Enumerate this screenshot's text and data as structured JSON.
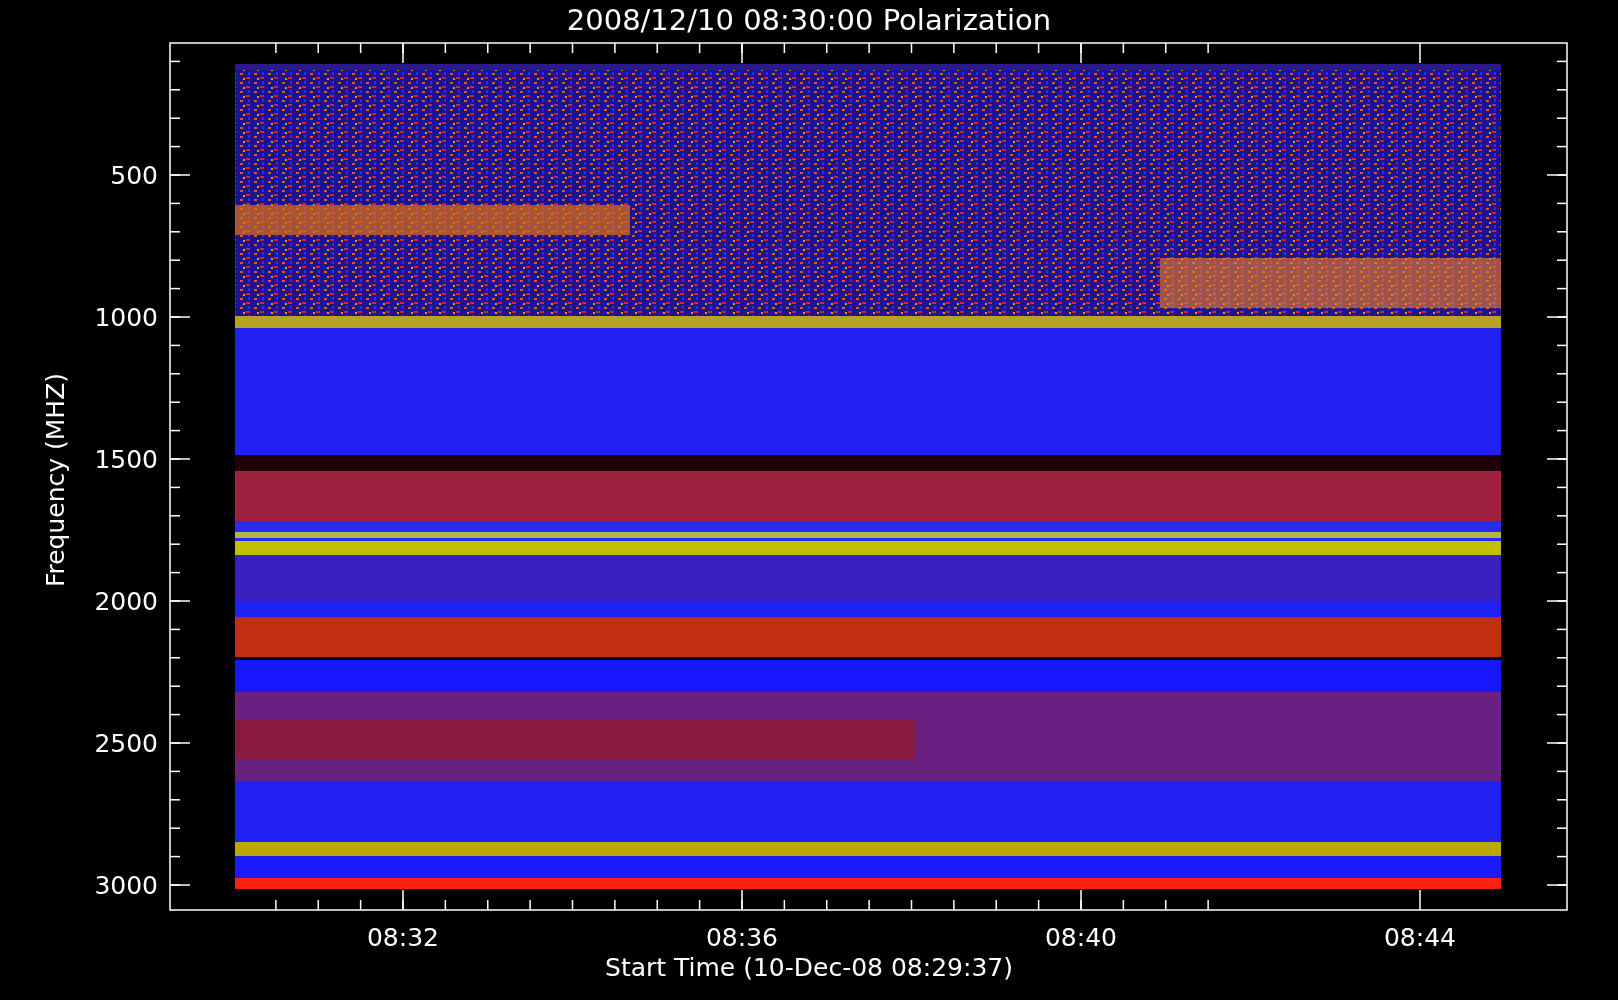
{
  "title": "2008/12/10 08:30:00 Polarization",
  "y_axis": {
    "label": "Frequency (MHZ)",
    "ticks": [
      "500",
      "1000",
      "1500",
      "2000",
      "2500",
      "3000"
    ]
  },
  "x_axis": {
    "label": "Start Time (10-Dec-08 08:29:37)",
    "ticks": [
      "08:32",
      "08:36",
      "08:40",
      "08:44"
    ]
  }
}
